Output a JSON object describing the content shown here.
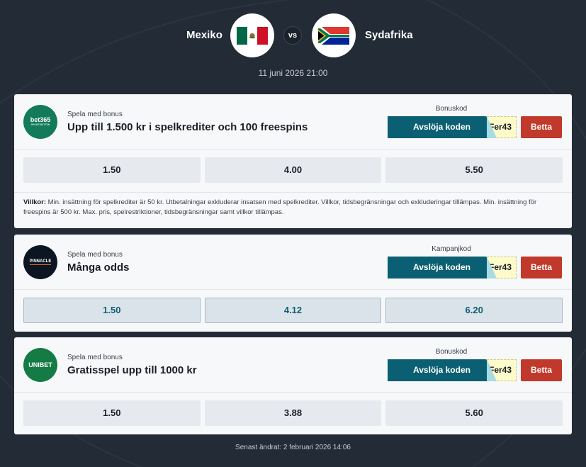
{
  "match": {
    "home_team": "Mexiko",
    "away_team": "Sydafrika",
    "vs": "vs",
    "date": "11 juni 2026 21:00"
  },
  "offers": [
    {
      "bookmaker": "bet365",
      "logo_text": "bet365",
      "logo_sub": "SPORTWETTEN",
      "bonus_small": "Spela med bonus",
      "bonus_title": "Upp till 1.500 kr i spelkrediter och 100 freespins",
      "code_label": "Bonuskod",
      "reveal_label": "Avslöja koden",
      "code_peek": "Fer43",
      "bet_label": "Betta",
      "odds": [
        "1.50",
        "4.00",
        "5.50"
      ],
      "terms_label": "Villkor:",
      "terms_text": " Min. insättning för spelkrediter är 50 kr. Utbetalningar exkluderar insatsen med spelkrediter. Villkor, tidsbegränsningar och exkluderingar tillämpas. Min. insättning för freespins är 500 kr. Max. pris, spelrestriktioner, tidsbegränsningar samt villkor tillämpas."
    },
    {
      "bookmaker": "Pinnacle",
      "logo_text": "PINNACLE",
      "bonus_small": "Spela med bonus",
      "bonus_title": "Många odds",
      "code_label": "Kampanjkod",
      "reveal_label": "Avslöja koden",
      "code_peek": "Fer43",
      "bet_label": "Betta",
      "odds": [
        "1.50",
        "4.12",
        "6.20"
      ]
    },
    {
      "bookmaker": "Unibet",
      "logo_text": "UNIBET",
      "bonus_small": "Spela med bonus",
      "bonus_title": "Gratisspel upp till 1000 kr",
      "code_label": "Bonuskod",
      "reveal_label": "Avslöja koden",
      "code_peek": "Fer43",
      "bet_label": "Betta",
      "odds": [
        "1.50",
        "3.88",
        "5.60"
      ]
    }
  ],
  "footer": "Senast ändrat: 2 februari 2026 14:06",
  "colors": {
    "background": "#232b36",
    "reveal_button": "#0b5f72",
    "bet_button": "#c0392b",
    "code_box": "#fdfbc9"
  }
}
